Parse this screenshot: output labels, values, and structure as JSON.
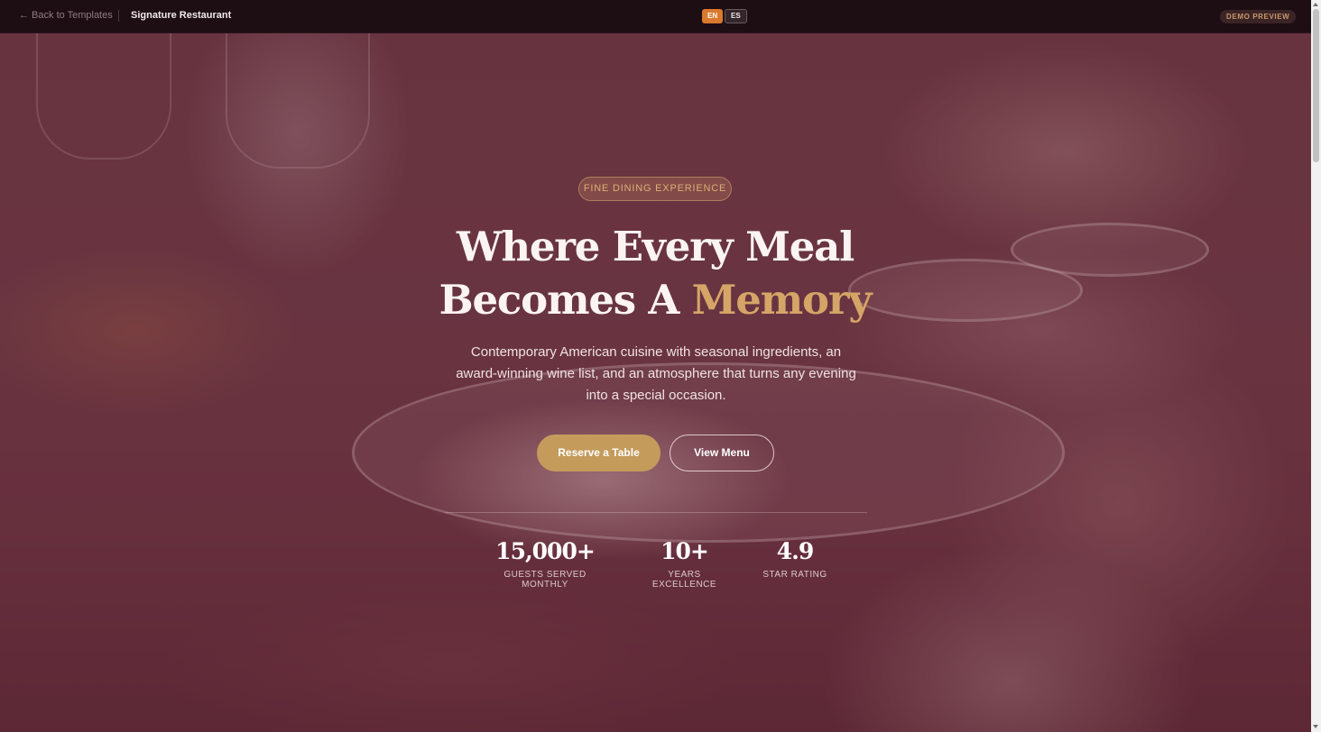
{
  "topbar": {
    "back_label": "← Back to Templates",
    "brand": "Signature Restaurant",
    "languages": [
      "EN",
      "ES"
    ],
    "active_language": "EN",
    "demo_badge": "DEMO PREVIEW"
  },
  "hero": {
    "eyebrow": "FINE DINING EXPERIENCE",
    "headline_line1": "Where Every Meal",
    "headline_line2": "Becomes A",
    "headline_accent": "Memory",
    "subheading": "Contemporary American cuisine with seasonal ingredients, an award-winning wine list, and an atmosphere that turns any evening into a special occasion.",
    "primary_cta": "Reserve a Table",
    "secondary_cta": "View Menu",
    "stats": [
      {
        "value": "15,000+",
        "label": "GUESTS SERVED MONTHLY"
      },
      {
        "value": "10+",
        "label": "YEARS EXCELLENCE"
      },
      {
        "value": "4.9",
        "label": "STAR RATING"
      }
    ]
  },
  "colors": {
    "accent_gold": "#c59b5c",
    "active_lang_orange": "#d9792d",
    "topbar_bg": "#1d0e13"
  }
}
